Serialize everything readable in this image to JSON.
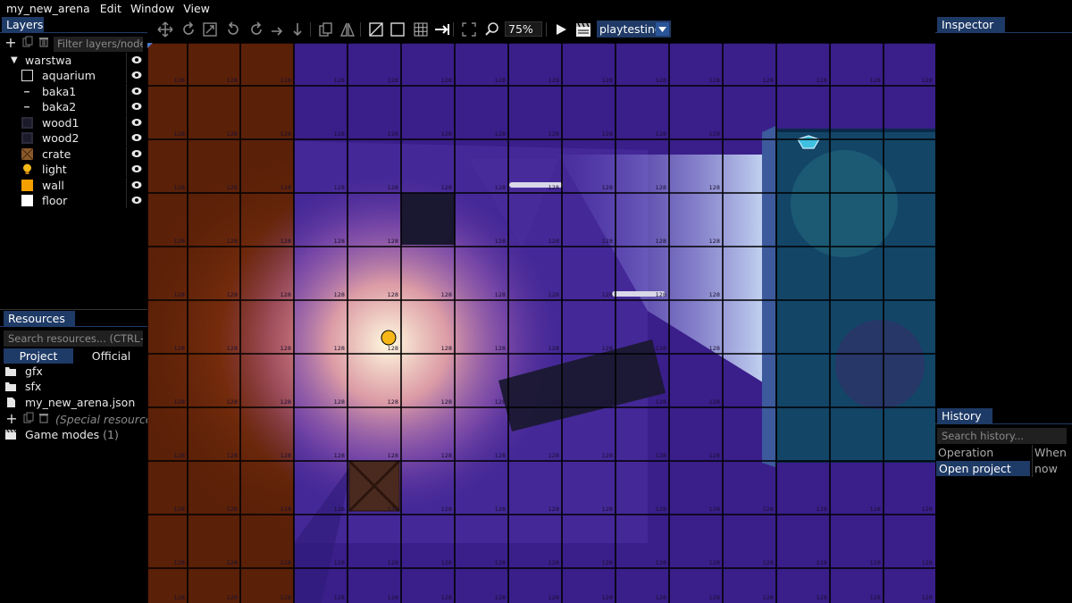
{
  "menu": {
    "project_name": "my_new_arena",
    "items": [
      "Edit",
      "Window",
      "View"
    ]
  },
  "layers_panel": {
    "tab_label": "Layers",
    "filter_placeholder": "Filter layers/node",
    "group": {
      "name": "warstwa",
      "expanded": true
    },
    "items": [
      {
        "label": "aquarium",
        "thumb": "empty-square"
      },
      {
        "label": "baka1",
        "thumb": "tiny-sprite"
      },
      {
        "label": "baka2",
        "thumb": "tiny-sprite"
      },
      {
        "label": "wood1",
        "thumb": "dark-tile"
      },
      {
        "label": "wood2",
        "thumb": "dark-tile"
      },
      {
        "label": "crate",
        "thumb": "crate-tile"
      },
      {
        "label": "light",
        "thumb": "bulb"
      },
      {
        "label": "wall",
        "thumb": "orange-square"
      },
      {
        "label": "floor",
        "thumb": "white-square"
      }
    ]
  },
  "resources_panel": {
    "tab_label": "Resources",
    "search_placeholder": "Search resources... (CTRL+",
    "tabs": [
      {
        "label": "Project",
        "active": true
      },
      {
        "label": "Official",
        "active": false
      }
    ],
    "files": [
      {
        "name": "gfx",
        "icon": "folder-icon"
      },
      {
        "name": "sfx",
        "icon": "folder-icon"
      },
      {
        "name": "my_new_arena.json",
        "icon": "file-icon"
      }
    ],
    "special_label": "(Special resources",
    "game_modes_label": "Game modes",
    "game_modes_count": "(1)"
  },
  "toolbar": {
    "zoom": "75%",
    "mode_select": "playtesting"
  },
  "canvas": {
    "tile_label": "128",
    "colors": {
      "floor": "#3a1e8a",
      "wall": "#5a2008",
      "grid": "#000000"
    }
  },
  "inspector": {
    "tab_label": "Inspector"
  },
  "history": {
    "tab_label": "History",
    "search_placeholder": "Search history...",
    "columns": [
      "Operation",
      "When"
    ],
    "rows": [
      {
        "operation": "Open project",
        "when": "now"
      }
    ]
  },
  "colors": {
    "accent": "#1e3a66",
    "panel_bg": "#000000"
  }
}
